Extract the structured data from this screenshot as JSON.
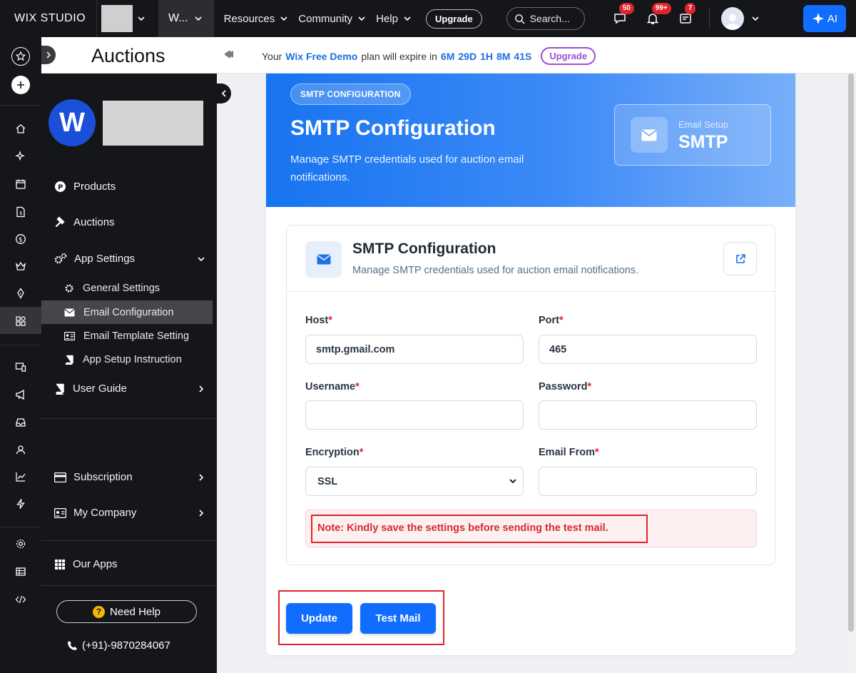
{
  "topbar": {
    "logo": "WIX STUDIO",
    "site_label": "W...",
    "nav": [
      "Resources",
      "Community",
      "Help"
    ],
    "upgrade": "Upgrade",
    "search_placeholder": "Search...",
    "badges": {
      "chat": "50",
      "notifications": "99+",
      "inbox": "7"
    },
    "ai_label": "AI"
  },
  "page": {
    "title": "Auctions",
    "banner_prefix": "Your",
    "banner_plan": "Wix Free Demo",
    "banner_mid": "plan will expire in",
    "countdown": [
      "6M",
      "29D",
      "1H",
      "8M",
      "41S"
    ],
    "banner_upgrade": "Upgrade"
  },
  "sidebar": {
    "items": [
      {
        "label": "Products"
      },
      {
        "label": "Auctions"
      },
      {
        "label": "App Settings"
      },
      {
        "label": "User Guide"
      },
      {
        "label": "Subscription"
      },
      {
        "label": "My Company"
      },
      {
        "label": "Our Apps"
      }
    ],
    "sub_items": [
      {
        "label": "General Settings"
      },
      {
        "label": "Email Configuration",
        "active": true
      },
      {
        "label": "Email Template Setting"
      },
      {
        "label": "App Setup Instruction"
      }
    ],
    "need_help": "Need Help",
    "phone": "(+91)-9870284067"
  },
  "hero": {
    "pill": "SMTP CONFIGURATION",
    "title": "SMTP Configuration",
    "description": "Manage SMTP credentials used for auction email notifications.",
    "box_label": "Email Setup",
    "box_value": "SMTP"
  },
  "form": {
    "title": "SMTP Configuration",
    "subtitle": "Manage SMTP credentials used for auction email notifications.",
    "host_label": "Host",
    "host_value": "smtp.gmail.com",
    "port_label": "Port",
    "port_value": "465",
    "username_label": "Username",
    "username_value": "",
    "password_label": "Password",
    "password_value": "",
    "encryption_label": "Encryption",
    "encryption_value": "SSL",
    "email_from_label": "Email From",
    "email_from_value": "",
    "required_mark": "*",
    "note": "Note: Kindly save the settings before sending the test mail."
  },
  "actions": {
    "update": "Update",
    "test_mail": "Test Mail"
  },
  "colors": {
    "accent": "#116dff",
    "highlight": "#e0242b",
    "sidebar_bg": "#15161a"
  }
}
